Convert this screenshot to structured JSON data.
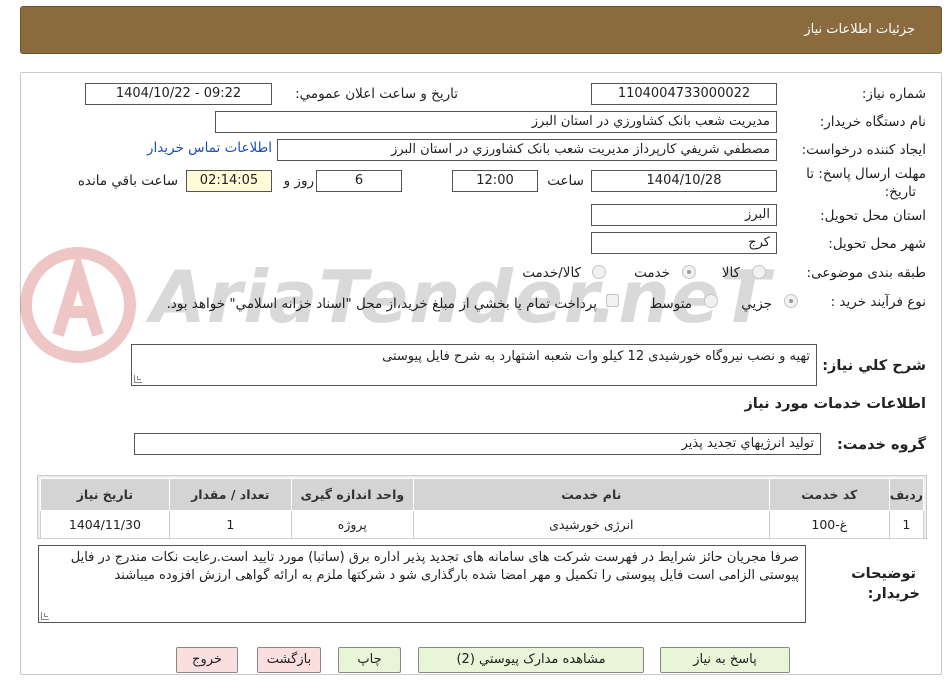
{
  "header": {
    "title": "جزئیات اطلاعات نیاز"
  },
  "form": {
    "need_number_label": "شماره نیاز:",
    "need_number": "1104004733000022",
    "announce_label": "تاریخ و ساعت اعلان عمومي:",
    "announce_value": "1404/10/22 - 09:22",
    "buyer_org_label": "نام دستگاه خريدار:",
    "buyer_org": "مديريت شعب بانک کشاورزي در استان البرز",
    "requester_label": "ايجاد کننده درخواست:",
    "requester": "مصطفي شريفي کارپرداز مديريت شعب بانک کشاورزي در استان البرز",
    "contact_link": "اطلاعات تماس خريدار",
    "deadline_label_1": "مهلت ارسال پاسخ: تا",
    "deadline_label_2": "تاريخ:",
    "deadline_date": "1404/10/28",
    "time_label": "ساعت",
    "deadline_time": "12:00",
    "days_value": "6",
    "days_label": "روز و",
    "remaining_time": "02:14:05",
    "remaining_label": "ساعت باقي مانده",
    "province_label": "استان محل تحويل:",
    "province": "البرز",
    "city_label": "شهر محل تحويل:",
    "city": "کرج",
    "category_label": "طبقه بندی موضوعی:",
    "category_options": [
      "کالا",
      "خدمت",
      "کالا/خدمت"
    ],
    "category_selected": "خدمت",
    "process_label": "نوع فرآیند خرید :",
    "process_options": [
      "جزيي",
      "متوسط"
    ],
    "process_selected": "جزيي",
    "payment_note": "پرداخت تمام يا بخشي از مبلغ خريد،از محل \"اسناد خزانه اسلامي\" خواهد بود.",
    "summary_label": "شرح کلي نياز:",
    "summary": "تهیه و نصب نیروگاه خورشیدی 12 کیلو وات شعبه اشتهارد به شرح فایل پیوستی",
    "services_heading": "اطلاعات خدمات مورد نياز",
    "service_group_label": "گروه خدمت:",
    "service_group": "توليد انرژيهاي تجديد پذير",
    "buyer_notes_label_1": "توضيحات",
    "buyer_notes_label_2": "خريدار:",
    "buyer_notes": "صرفا مجریان حائز شرایط در فهرست شرکت های سامانه های تجدید پذیر اداره برق (ساتبا) مورد تایید است.رعایت نکات مندرج در فایل پیوستی الزامی است فایل پیوستی را تکمیل و مهر امضا شده بارگذاری شو د شرکتها ملزم به ارائه گواهی ارزش افزوده میباشند"
  },
  "table": {
    "headers": [
      "رديف",
      "کد خدمت",
      "نام خدمت",
      "واحد اندازه گيری",
      "تعداد / مقدار",
      "تاريخ نياز"
    ],
    "rows": [
      [
        "1",
        "غ-100",
        "انرژی خورشیدی",
        "پروژه",
        "1",
        "1404/11/30"
      ]
    ]
  },
  "buttons": {
    "respond": "پاسخ به نياز",
    "attachments": "مشاهده مدارک پيوستي (2)",
    "print": "چاپ",
    "back": "بازگشت",
    "exit": "خروج"
  },
  "watermark": {
    "text": "AriaTender.neT"
  },
  "colors": {
    "header_bg": "#8b6a3e",
    "link": "#1a4fb5",
    "time_bg": "#fefbd8",
    "green_btn": "#e8f5d9",
    "pink_btn": "#fbdede"
  }
}
